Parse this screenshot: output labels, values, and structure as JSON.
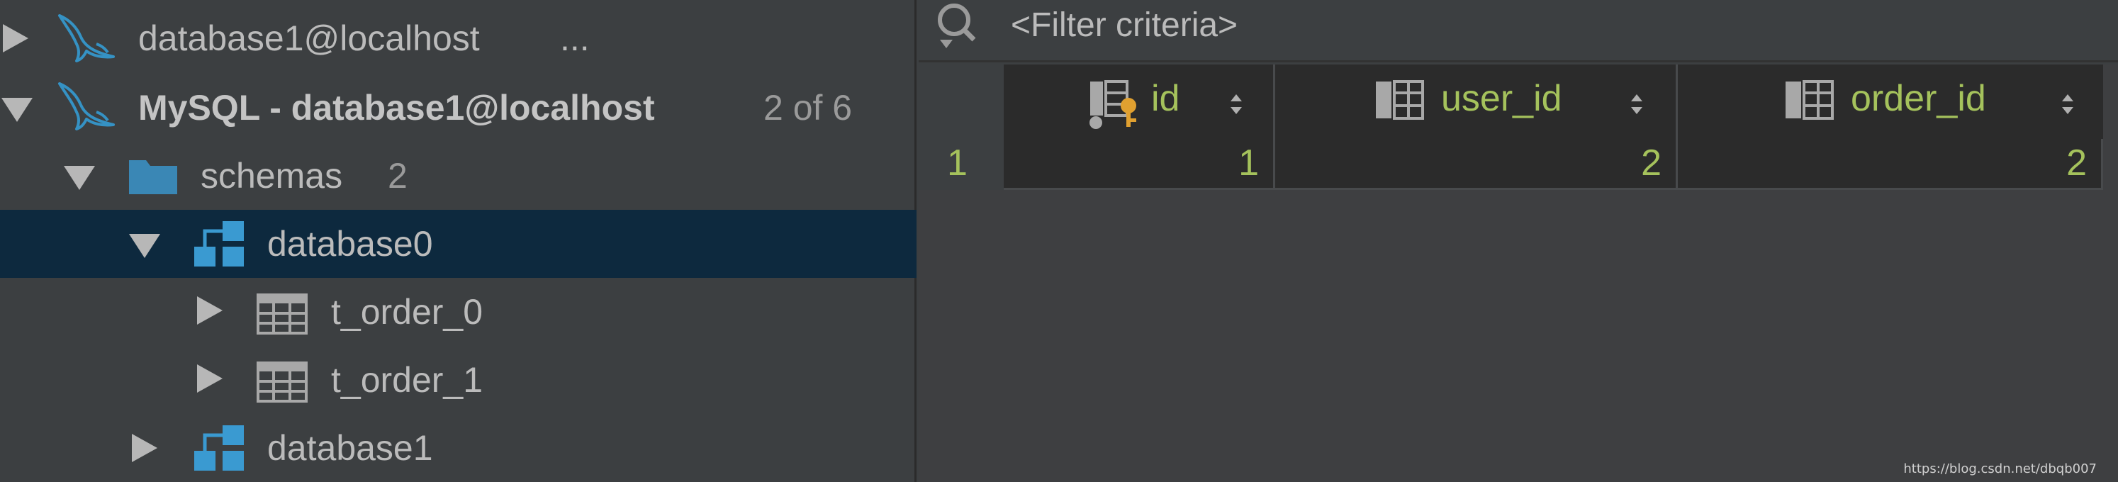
{
  "tree": {
    "nodes": [
      {
        "label": "database1@localhost",
        "suffix": "...",
        "icon": "mysql-dolphin-icon",
        "expanded": false
      },
      {
        "label": "MySQL - database1@localhost",
        "suffix": "2 of 6",
        "icon": "mysql-dolphin-icon",
        "expanded": true
      },
      {
        "label": "schemas",
        "suffix": "2",
        "icon": "folder-icon",
        "expanded": true
      },
      {
        "label": "database0",
        "suffix": "",
        "icon": "schema-icon",
        "expanded": true,
        "selected": true
      },
      {
        "label": "t_order_0",
        "suffix": "",
        "icon": "table-icon",
        "expanded": false
      },
      {
        "label": "t_order_1",
        "suffix": "",
        "icon": "table-icon",
        "expanded": false
      },
      {
        "label": "database1",
        "suffix": "",
        "icon": "schema-icon",
        "expanded": false
      }
    ]
  },
  "filter": {
    "placeholder": "<Filter criteria>"
  },
  "grid": {
    "columns": [
      {
        "name": "id",
        "icon": "primary-key-column-icon"
      },
      {
        "name": "user_id",
        "icon": "column-icon"
      },
      {
        "name": "order_id",
        "icon": "column-icon"
      }
    ],
    "rows": [
      {
        "num": "1",
        "values": [
          "1",
          "2",
          "2"
        ]
      }
    ]
  },
  "watermark": "https://blog.csdn.net/dbqb007",
  "colors": {
    "background": "#3c3f41",
    "grid": "#2b2b2b",
    "selection": "#0d293e",
    "value_text": "#a5c25c",
    "text": "#bbbbbb"
  }
}
